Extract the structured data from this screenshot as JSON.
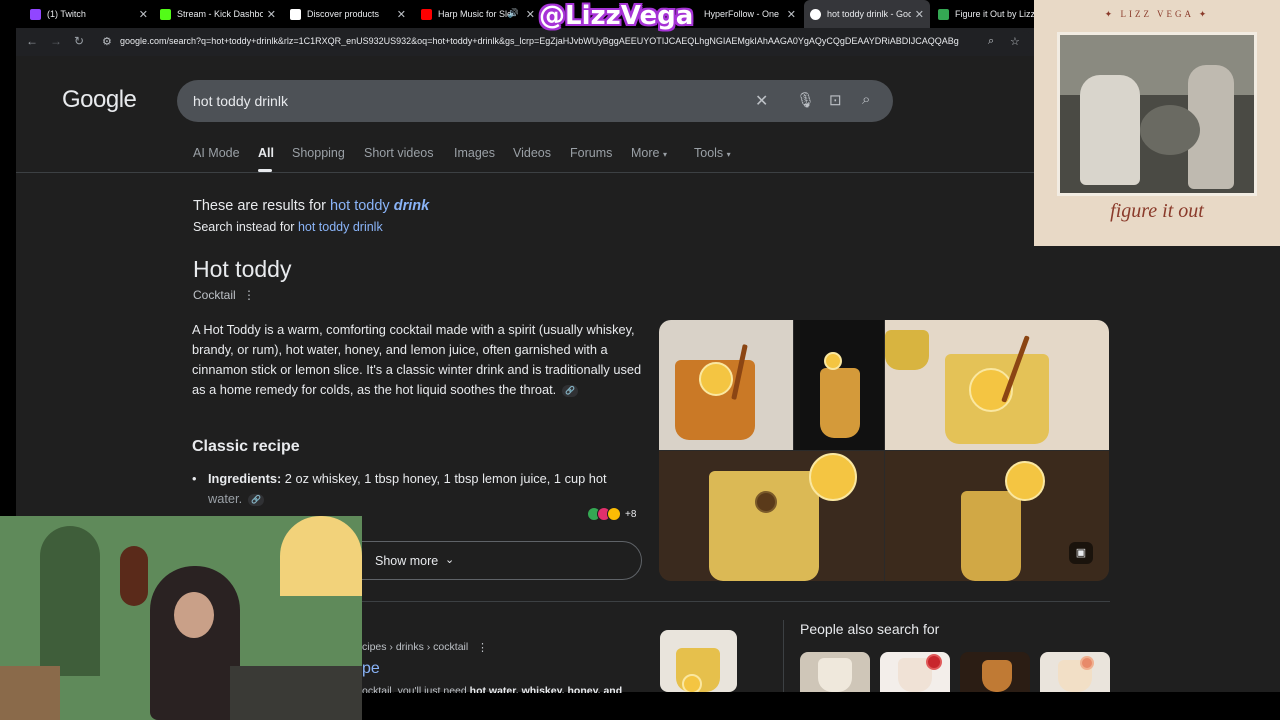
{
  "tabs": [
    {
      "label": "(1) Twitch",
      "color": "#9146ff"
    },
    {
      "label": "Stream - Kick Dashboar",
      "color": "#53fc18"
    },
    {
      "label": "Discover products",
      "color": "#ffffff"
    },
    {
      "label": "Harp Music for Sle",
      "color": "#ff0000"
    },
    {
      "label": "HyperFollow - One pag",
      "color": "#7c4dff"
    },
    {
      "label": "hot toddy drinlk - Goo",
      "color": "#ffffff"
    },
    {
      "label": "Figure it Out by Lizz V",
      "color": "#34a853"
    }
  ],
  "address": {
    "url": "google.com/search?q=hot+toddy+drinlk&rlz=1C1RXQR_enUS932US932&oq=hot+toddy+drinlk&gs_lcrp=EgZjaHJvbWUyBggAEEUYOTIJCAEQLhgNGIAEMgkIAhAAGA0YgAQyCQgDEAAYDRiABDIJCAQQABg"
  },
  "google": {
    "logo": "Google",
    "query": "hot toddy drinlk",
    "tabs": [
      "AI Mode",
      "All",
      "Shopping",
      "Short videos",
      "Images",
      "Videos",
      "Forums",
      "More",
      "Tools"
    ],
    "correction_prefix": "These are results for",
    "correction_link_plain": "hot toddy",
    "correction_link_em": "drink",
    "instead_prefix": "Search instead for",
    "instead_link": "hot toddy drinlk"
  },
  "knowledge": {
    "title": "Hot toddy",
    "subtitle": "Cocktail",
    "description": "A Hot Toddy is a warm, comforting cocktail made with a spirit (usually whiskey, brandy, or rum), hot water, honey, and lemon juice, often garnished with a cinnamon stick or lemon slice. It's a classic winter drink and is traditionally used as a home remedy for colds, as the hot liquid soothes the throat.",
    "recipe_heading": "Classic recipe",
    "ingredients_label": "Ingredients:",
    "ingredients_text": "2 oz whiskey, 1 tbsp honey, 1 tbsp lemon juice, 1 cup hot",
    "ingredients_fade": "water.",
    "sources_more": "+8",
    "show_more": "Show more"
  },
  "result": {
    "breadcrumb": "cipes › drinks › cocktail",
    "title": "pe",
    "snippet_plain": "ocktail, you'll just need",
    "snippet_bold": "hot water, whiskey, honey, and"
  },
  "people_also_search": {
    "title": "People also search for"
  },
  "album": {
    "artist": "LIZZ VEGA",
    "title": "figure it out"
  },
  "overlay": {
    "handle": "@LizzVega"
  },
  "icons": {
    "back": "back-arrow-icon",
    "forward": "forward-arrow-icon",
    "reload": "reload-icon",
    "clear": "close-icon",
    "mic": "microphone-icon",
    "lens": "camera-lens-icon",
    "search": "search-icon"
  },
  "colors": {
    "link": "#8ab4f8",
    "page_bg": "#1f1f1f",
    "searchbox": "#4d5156",
    "handle_outline": "#a633d6"
  }
}
